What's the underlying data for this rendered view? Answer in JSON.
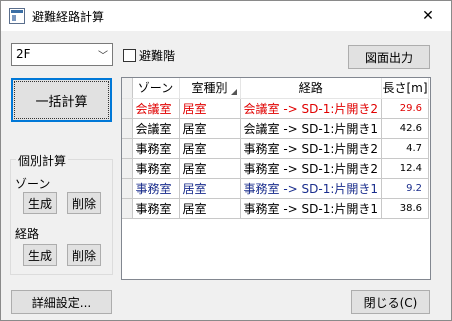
{
  "window": {
    "title": "避難経路計算",
    "close_glyph": "✕"
  },
  "toolbar": {
    "floor_select": {
      "value": "2F",
      "chevron": "﹀"
    },
    "evac_floor_checkbox": {
      "label": "避難階",
      "checked": false
    },
    "export_button": "図面出力"
  },
  "left": {
    "bulk_button": "一括計算",
    "individual_group": {
      "title": "個別計算",
      "zone_label": "ゾーン",
      "zone_create": "生成",
      "zone_delete": "削除",
      "route_label": "経路",
      "route_create": "生成",
      "route_delete": "削除"
    }
  },
  "table": {
    "columns": [
      "ゾーン",
      "室種別",
      "経路",
      "長さ[m]"
    ],
    "rows": [
      {
        "zone": "会議室",
        "type": "居室",
        "route": "会議室 -> SD-1:片開き2",
        "length": "29.6",
        "color": "#e00000"
      },
      {
        "zone": "会議室",
        "type": "居室",
        "route": "会議室 -> SD-1:片開き1",
        "length": "42.6",
        "color": "#000000"
      },
      {
        "zone": "事務室",
        "type": "居室",
        "route": "事務室 -> SD-1:片開き2",
        "length": "4.7",
        "color": "#000000"
      },
      {
        "zone": "事務室",
        "type": "居室",
        "route": "事務室 -> SD-1:片開き2",
        "length": "12.4",
        "color": "#000000"
      },
      {
        "zone": "事務室",
        "type": "居室",
        "route": "事務室 -> SD-1:片開き1",
        "length": "9.2",
        "color": "#1a2d8c"
      },
      {
        "zone": "事務室",
        "type": "居室",
        "route": "事務室 -> SD-1:片開き1",
        "length": "38.6",
        "color": "#000000"
      }
    ]
  },
  "footer": {
    "detail_button": "詳細設定...",
    "close_button": "閉じる(C)"
  }
}
